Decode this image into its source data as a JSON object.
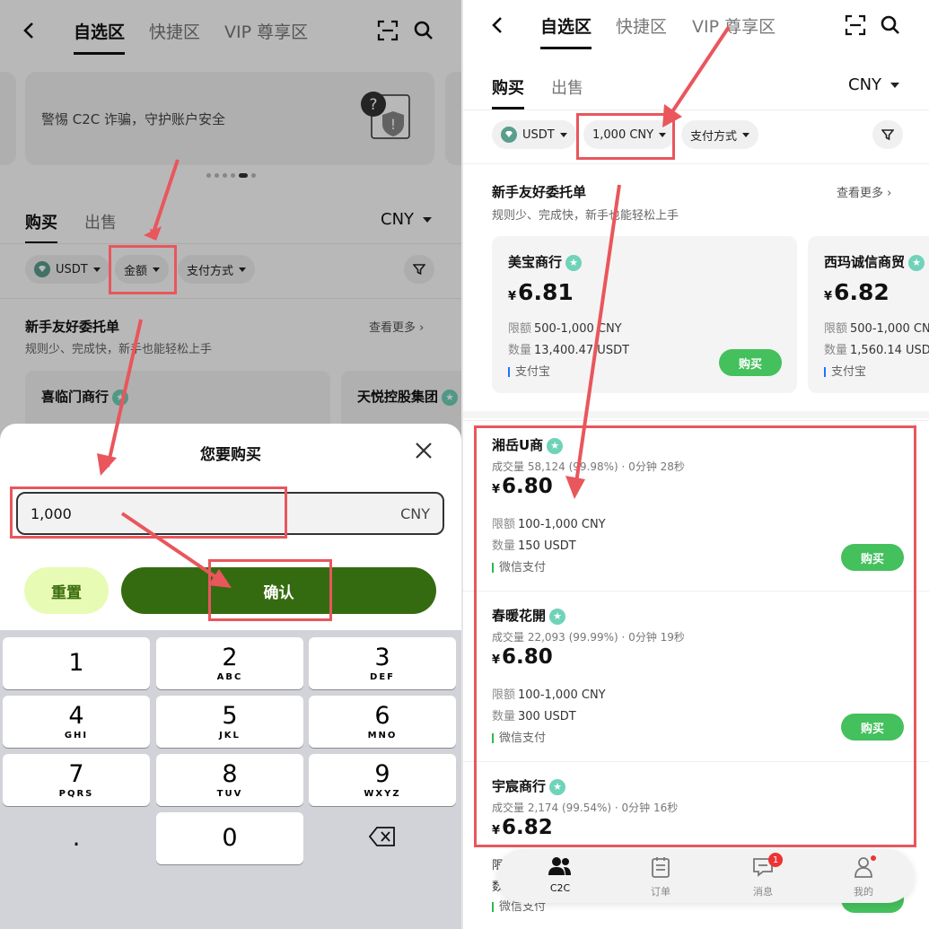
{
  "left": {
    "header": {
      "tabs": [
        "自选区",
        "快捷区",
        "VIP 尊享区"
      ]
    },
    "banner": {
      "text": "警惕 C2C 诈骗，守护账户安全"
    },
    "subtabs": {
      "buy": "购买",
      "sell": "出售",
      "currency": "CNY"
    },
    "filters": {
      "coin": "USDT",
      "amount": "金额",
      "payment": "支付方式"
    },
    "newbie": {
      "title": "新手友好委托单",
      "subtitle": "规则少、完成快，新手也能轻松上手",
      "more": "查看更多"
    },
    "merchants": [
      {
        "name": "喜临门商行"
      },
      {
        "name": "天悦控股集团"
      }
    ],
    "sheet": {
      "title": "您要购买",
      "input_value": "1,000",
      "input_unit": "CNY",
      "reset": "重置",
      "confirm": "确认"
    },
    "keypad": [
      {
        "n": "1",
        "l": ""
      },
      {
        "n": "2",
        "l": "ABC"
      },
      {
        "n": "3",
        "l": "DEF"
      },
      {
        "n": "4",
        "l": "GHI"
      },
      {
        "n": "5",
        "l": "JKL"
      },
      {
        "n": "6",
        "l": "MNO"
      },
      {
        "n": "7",
        "l": "PQRS"
      },
      {
        "n": "8",
        "l": "TUV"
      },
      {
        "n": "9",
        "l": "WXYZ"
      },
      {
        "n": ".",
        "l": ""
      },
      {
        "n": "0",
        "l": ""
      }
    ]
  },
  "right": {
    "header": {
      "tabs": [
        "自选区",
        "快捷区",
        "VIP 尊享区"
      ]
    },
    "subtabs": {
      "buy": "购买",
      "sell": "出售",
      "currency": "CNY"
    },
    "filters": {
      "coin": "USDT",
      "amount": "1,000 CNY",
      "payment": "支付方式"
    },
    "newbie": {
      "title": "新手友好委托单",
      "subtitle": "规则少、完成快，新手也能轻松上手",
      "more": "查看更多"
    },
    "merchants": [
      {
        "name": "美宝商行",
        "price": "6.81",
        "limit_label": "限额",
        "limit": "500-1,000 CNY",
        "qty_label": "数量",
        "qty": "13,400.47 USDT",
        "pay": "支付宝",
        "buy": "购买"
      },
      {
        "name": "西玛诚信商贸",
        "price": "6.82",
        "limit_label": "限额",
        "limit": "500-1,000 CN",
        "qty_label": "数量",
        "qty": "1,560.14 USD",
        "pay": "支付宝"
      }
    ],
    "ads": [
      {
        "name": "湘岳U商",
        "stats": "成交量 58,124 (99.98%)  ·  0分钟 28秒",
        "price": "6.80",
        "limit_label": "限额",
        "limit": "100-1,000 CNY",
        "qty_label": "数量",
        "qty": "150 USDT",
        "pay": "微信支付",
        "buy": "购买"
      },
      {
        "name": "春暖花開",
        "stats": "成交量 22,093 (99.99%)  ·  0分钟 19秒",
        "price": "6.80",
        "limit_label": "限额",
        "limit": "100-1,000 CNY",
        "qty_label": "数量",
        "qty": "300 USDT",
        "pay": "微信支付",
        "buy": "购买"
      },
      {
        "name": "宇宸商行",
        "stats": "成交量 2,174 (99.54%)  ·  0分钟 16秒",
        "price": "6.82"
      }
    ],
    "bottom_nav": [
      {
        "label": "C2C"
      },
      {
        "label": "订单"
      },
      {
        "label": "消息",
        "badge": "1"
      },
      {
        "label": "我的"
      }
    ],
    "peek": {
      "limit_prefix": "限",
      "qty_prefix": "数",
      "pay": "微信支付"
    }
  },
  "colors": {
    "buy_green": "#44c05d",
    "confirm_green": "#356b10",
    "annotation_red": "#e9565c",
    "alipay_blue": "#1677ff",
    "wechat_green": "#2db84d"
  },
  "currency_symbol": "¥"
}
